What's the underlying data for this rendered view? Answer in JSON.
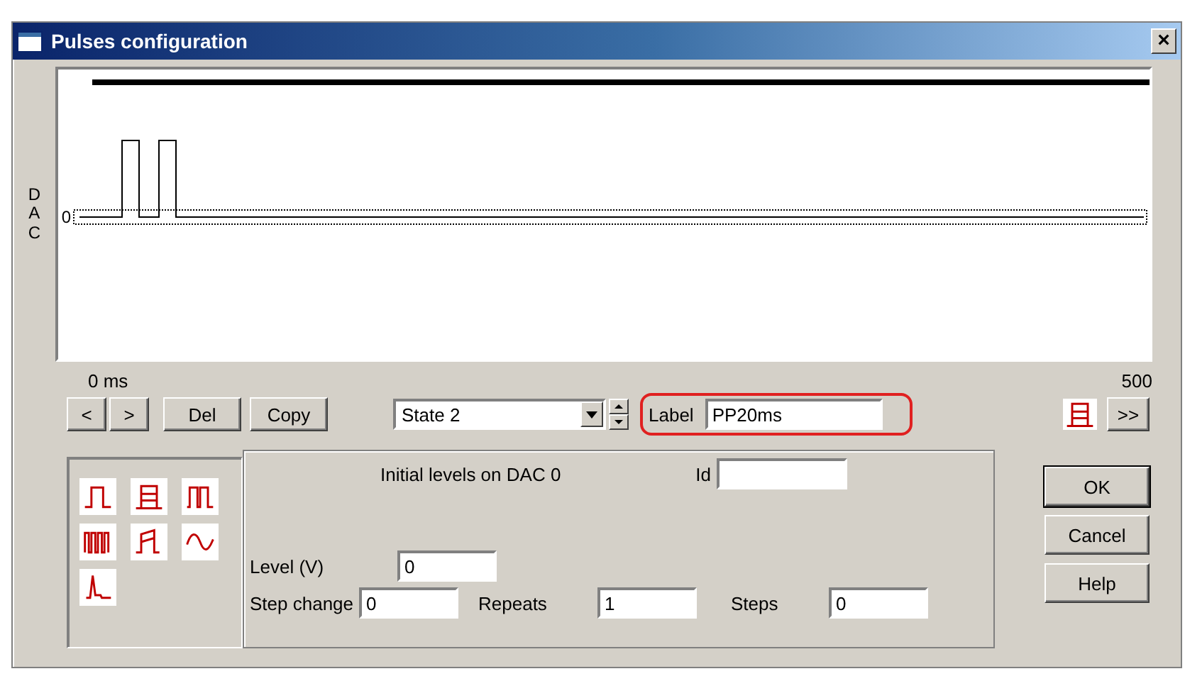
{
  "window": {
    "title": "Pulses configuration",
    "close": "×"
  },
  "plot": {
    "axis_label": "DAC",
    "zero_label": "0",
    "x_start": "0 ms",
    "x_end": "500"
  },
  "nav_buttons": [
    "<",
    ">"
  ],
  "action_buttons": [
    "Del",
    "Copy"
  ],
  "state_select": {
    "value": "State 2"
  },
  "label_field": {
    "label": "Label",
    "value": "PP20ms",
    "highlighted": true
  },
  "current_type": {
    "kind": "steps"
  },
  "next_button": ">>",
  "palette": [
    {
      "kind": "pulse"
    },
    {
      "kind": "steps"
    },
    {
      "kind": "double"
    },
    {
      "kind": "train"
    },
    {
      "kind": "ramp"
    },
    {
      "kind": "sine"
    },
    {
      "kind": "spike"
    }
  ],
  "levels_group": {
    "title": "Initial levels on DAC 0",
    "id_label": "Id"
  },
  "fields": [
    {
      "label": "Level (V)",
      "value": "0"
    },
    {
      "label": "Step change",
      "value": "0"
    },
    {
      "label": "Repeats",
      "value": "1"
    },
    {
      "label": "Steps",
      "value": "0"
    }
  ],
  "buttons": [
    {
      "label": "OK",
      "default": true
    },
    {
      "label": "Cancel",
      "default": false
    },
    {
      "label": "Help",
      "default": false
    }
  ]
}
